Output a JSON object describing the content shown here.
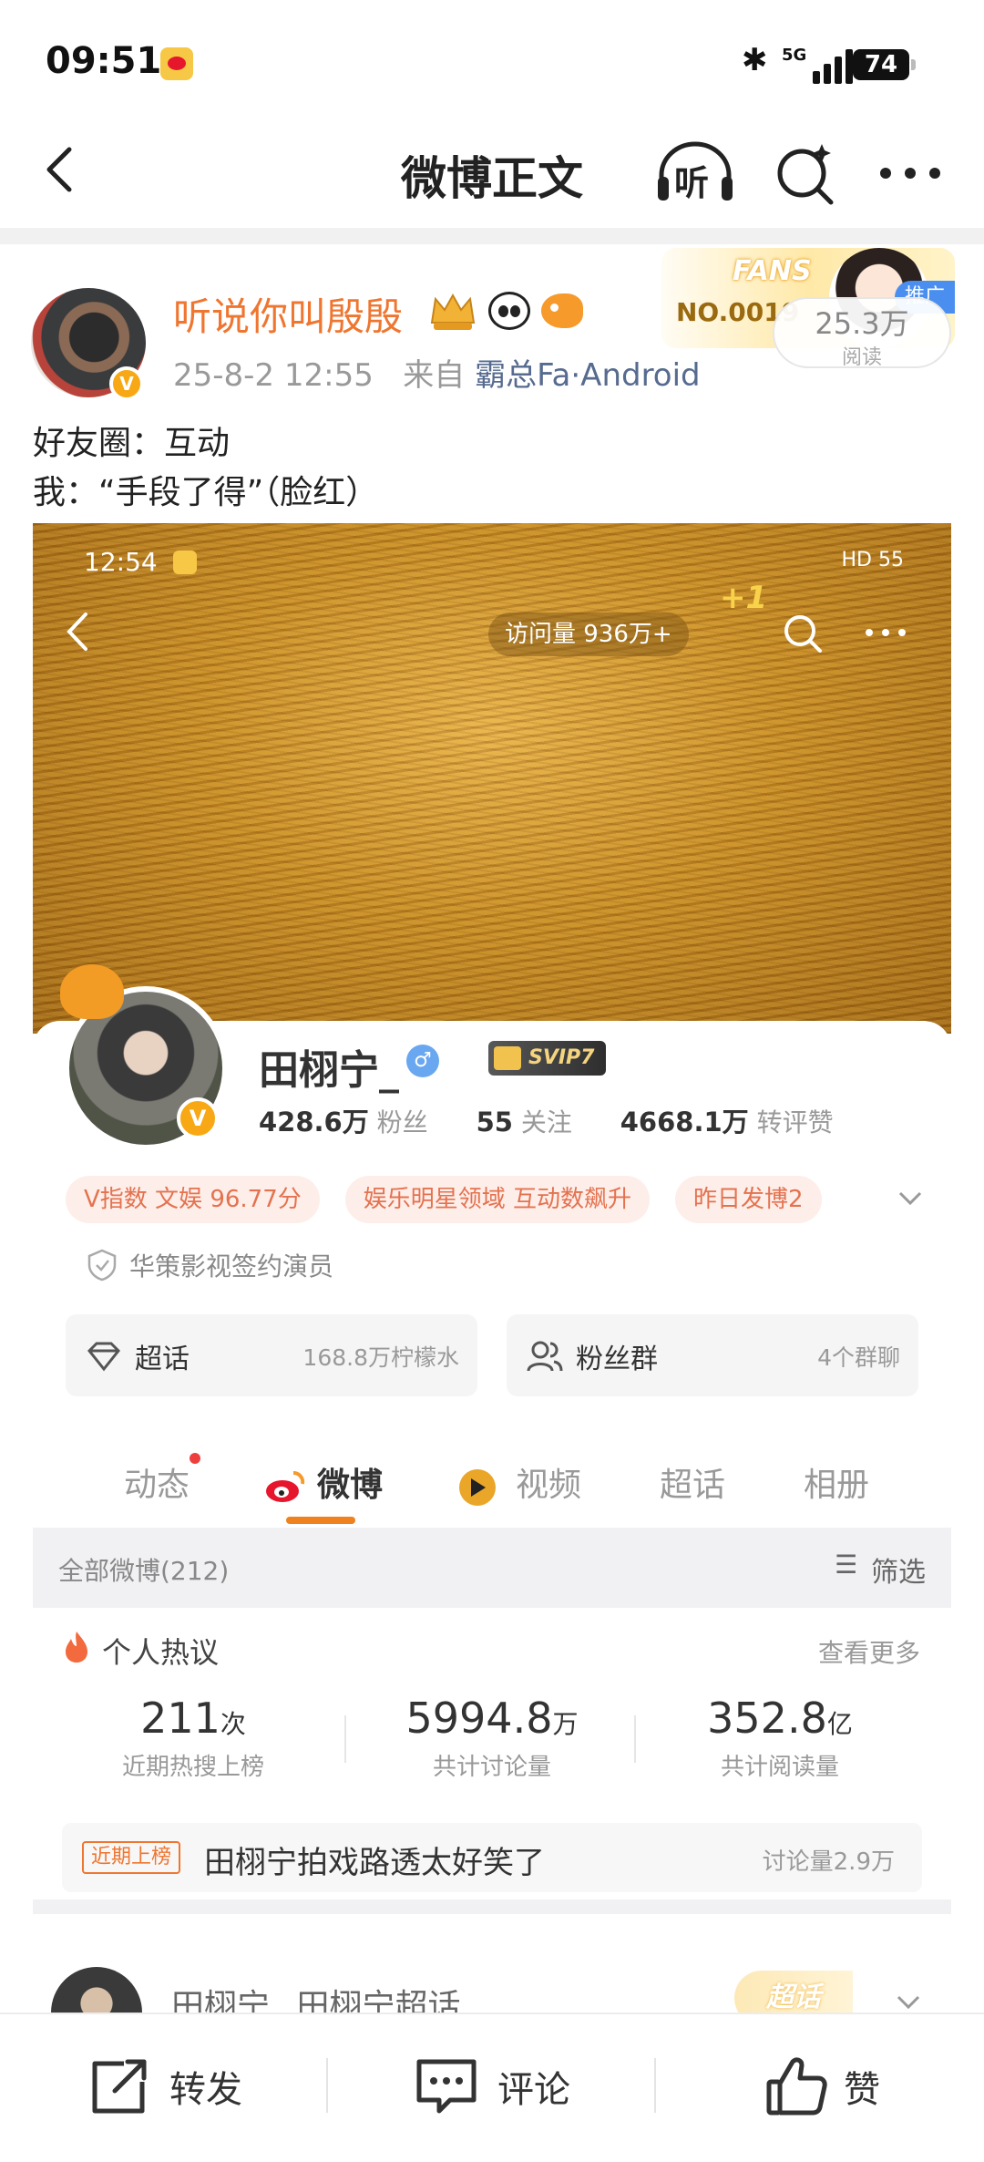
{
  "status_bar": {
    "time": "09:51",
    "network": "5G",
    "battery": "74"
  },
  "nav": {
    "title": "微博正文",
    "listen_label": "听"
  },
  "post": {
    "username": "听说你叫殷殷",
    "date": "25-8-2 12:55",
    "source_prefix": "来自",
    "source": "霸总Fa·Android",
    "text_line1": "好友圈：互动",
    "text_line2": "我：“手段了得”（脸红）"
  },
  "fans_card": {
    "label": "FANS",
    "number": "NO.0019",
    "ad_label": "推广"
  },
  "reads": {
    "count": "25.3万",
    "label": "阅读"
  },
  "embedded": {
    "time": "12:54",
    "status_right": "HD 55",
    "visits": "访问量 936万+",
    "plus": "+1",
    "name": "田栩宁_",
    "svip": "SVIP7",
    "stats": {
      "fans_value": "428.6万",
      "fans_label": "粉丝",
      "follow_value": "55",
      "follow_label": "关注",
      "reposts_value": "4668.1万",
      "reposts_label": "转评赞"
    },
    "chips": [
      "V指数 文娱 96.77分",
      "娱乐明星领域 互动数飙升",
      "昨日发博2"
    ],
    "certification": "华策影视签约演员",
    "supertopic": {
      "label": "超话",
      "value": "168.8万柠檬水"
    },
    "fan_group": {
      "label": "粉丝群",
      "value": "4个群聊"
    },
    "tabs": [
      "动态",
      "微博",
      "视频",
      "超话",
      "相册"
    ],
    "filter": {
      "left": "全部微博(212)",
      "right": "筛选"
    },
    "hot": {
      "title": "个人热议",
      "more": "查看更多",
      "stats": [
        {
          "value": "211",
          "unit": "次",
          "label": "近期热搜上榜"
        },
        {
          "value": "5994.8",
          "unit": "万",
          "label": "共计讨论量"
        },
        {
          "value": "352.8",
          "unit": "亿",
          "label": "共计阅读量"
        }
      ],
      "recent_tag": "近期上榜",
      "recent_text": "田栩宁拍戏路透太好笑了",
      "recent_count": "讨论量2.9万"
    }
  },
  "peek": {
    "text": "田栩宁_  田栩宁超话",
    "badge": "超话"
  },
  "toolbar": {
    "repost": "转发",
    "comment": "评论",
    "like": "赞"
  }
}
